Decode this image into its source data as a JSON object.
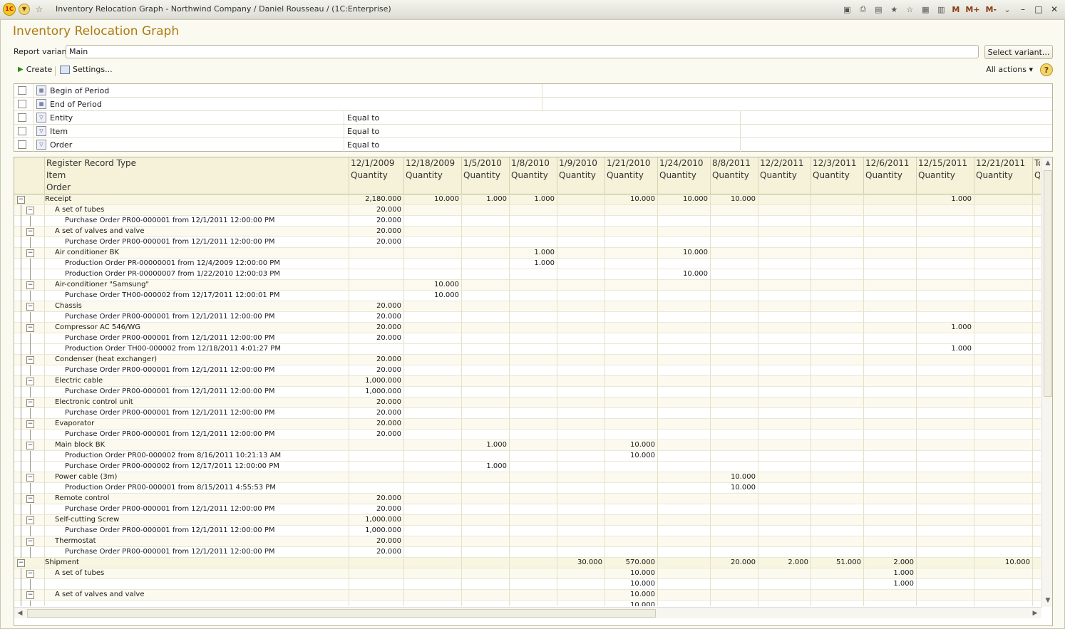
{
  "window": {
    "title": "Inventory Relocation Graph - Northwind Company / Daniel Rousseau /  (1C:Enterprise)",
    "logo": "1C",
    "memory_buttons": [
      "M",
      "M+",
      "M-"
    ]
  },
  "page": {
    "title": "Inventory Relocation Graph",
    "variant_label": "Report variant:",
    "variant_value": "Main",
    "select_variant_label": "Select variant..."
  },
  "toolbar": {
    "create_label": "Create",
    "settings_label": "Settings...",
    "all_actions_label": "All actions ▾",
    "help_label": "?"
  },
  "filters": [
    {
      "name": "Begin of Period",
      "condition": "",
      "icon": "calendar-icon"
    },
    {
      "name": "End of Period",
      "condition": "",
      "icon": "calendar-icon"
    },
    {
      "name": "Entity",
      "condition": "Equal to",
      "icon": "filter-icon"
    },
    {
      "name": "Item",
      "condition": "Equal to",
      "icon": "filter-icon"
    },
    {
      "name": "Order",
      "condition": "Equal to",
      "icon": "filter-icon"
    }
  ],
  "report": {
    "header_groups": [
      "Register Record Type",
      "Item",
      "Order"
    ],
    "dates": [
      "12/1/2009",
      "12/18/2009",
      "1/5/2010",
      "1/8/2010",
      "1/9/2010",
      "1/21/2010",
      "1/24/2010",
      "8/8/2011",
      "12/2/2011",
      "12/3/2011",
      "12/6/2011",
      "12/15/2011",
      "12/21/2011",
      "To"
    ],
    "measure": "Quantity",
    "rows": [
      {
        "level": 0,
        "label": "Receipt",
        "values": [
          "2,180.000",
          "10.000",
          "1.000",
          "1.000",
          "",
          "10.000",
          "10.000",
          "10.000",
          "",
          "",
          "",
          "1.000",
          ""
        ]
      },
      {
        "level": 1,
        "label": "A set of tubes",
        "values": [
          "20.000",
          "",
          "",
          "",
          "",
          "",
          "",
          "",
          "",
          "",
          "",
          "",
          ""
        ]
      },
      {
        "level": 2,
        "label": "Purchase Order PR00-000001 from 12/1/2011 12:00:00 PM",
        "values": [
          "20.000",
          "",
          "",
          "",
          "",
          "",
          "",
          "",
          "",
          "",
          "",
          "",
          ""
        ]
      },
      {
        "level": 1,
        "label": "A set of valves and valve",
        "values": [
          "20.000",
          "",
          "",
          "",
          "",
          "",
          "",
          "",
          "",
          "",
          "",
          "",
          ""
        ]
      },
      {
        "level": 2,
        "label": "Purchase Order PR00-000001 from 12/1/2011 12:00:00 PM",
        "values": [
          "20.000",
          "",
          "",
          "",
          "",
          "",
          "",
          "",
          "",
          "",
          "",
          "",
          ""
        ]
      },
      {
        "level": 1,
        "label": "Air conditioner BK",
        "values": [
          "",
          "",
          "",
          "1.000",
          "",
          "",
          "10.000",
          "",
          "",
          "",
          "",
          "",
          ""
        ]
      },
      {
        "level": 2,
        "label": "Production Order PR-00000001 from 12/4/2009 12:00:00 PM",
        "values": [
          "",
          "",
          "",
          "1.000",
          "",
          "",
          "",
          "",
          "",
          "",
          "",
          "",
          ""
        ]
      },
      {
        "level": 2,
        "label": "Production Order PR-00000007 from 1/22/2010 12:00:03 PM",
        "values": [
          "",
          "",
          "",
          "",
          "",
          "",
          "10.000",
          "",
          "",
          "",
          "",
          "",
          ""
        ]
      },
      {
        "level": 1,
        "label": "Air-conditioner \"Samsung\"",
        "values": [
          "",
          "10.000",
          "",
          "",
          "",
          "",
          "",
          "",
          "",
          "",
          "",
          "",
          ""
        ]
      },
      {
        "level": 2,
        "label": "Purchase Order TH00-000002 from 12/17/2011 12:00:01 PM",
        "values": [
          "",
          "10.000",
          "",
          "",
          "",
          "",
          "",
          "",
          "",
          "",
          "",
          "",
          ""
        ]
      },
      {
        "level": 1,
        "label": "Chassis",
        "values": [
          "20.000",
          "",
          "",
          "",
          "",
          "",
          "",
          "",
          "",
          "",
          "",
          "",
          ""
        ]
      },
      {
        "level": 2,
        "label": "Purchase Order PR00-000001 from 12/1/2011 12:00:00 PM",
        "values": [
          "20.000",
          "",
          "",
          "",
          "",
          "",
          "",
          "",
          "",
          "",
          "",
          "",
          ""
        ]
      },
      {
        "level": 1,
        "label": "Compressor AC 546/WG",
        "values": [
          "20.000",
          "",
          "",
          "",
          "",
          "",
          "",
          "",
          "",
          "",
          "",
          "1.000",
          ""
        ]
      },
      {
        "level": 2,
        "label": "Purchase Order PR00-000001 from 12/1/2011 12:00:00 PM",
        "values": [
          "20.000",
          "",
          "",
          "",
          "",
          "",
          "",
          "",
          "",
          "",
          "",
          "",
          ""
        ]
      },
      {
        "level": 2,
        "label": "Production Order TH00-000002 from 12/18/2011 4:01:27 PM",
        "values": [
          "",
          "",
          "",
          "",
          "",
          "",
          "",
          "",
          "",
          "",
          "",
          "1.000",
          ""
        ]
      },
      {
        "level": 1,
        "label": "Condenser (heat exchanger)",
        "values": [
          "20.000",
          "",
          "",
          "",
          "",
          "",
          "",
          "",
          "",
          "",
          "",
          "",
          ""
        ]
      },
      {
        "level": 2,
        "label": "Purchase Order PR00-000001 from 12/1/2011 12:00:00 PM",
        "values": [
          "20.000",
          "",
          "",
          "",
          "",
          "",
          "",
          "",
          "",
          "",
          "",
          "",
          ""
        ]
      },
      {
        "level": 1,
        "label": "Electric cable",
        "values": [
          "1,000.000",
          "",
          "",
          "",
          "",
          "",
          "",
          "",
          "",
          "",
          "",
          "",
          ""
        ]
      },
      {
        "level": 2,
        "label": "Purchase Order PR00-000001 from 12/1/2011 12:00:00 PM",
        "values": [
          "1,000.000",
          "",
          "",
          "",
          "",
          "",
          "",
          "",
          "",
          "",
          "",
          "",
          ""
        ]
      },
      {
        "level": 1,
        "label": "Electronic control unit",
        "values": [
          "20.000",
          "",
          "",
          "",
          "",
          "",
          "",
          "",
          "",
          "",
          "",
          "",
          ""
        ]
      },
      {
        "level": 2,
        "label": "Purchase Order PR00-000001 from 12/1/2011 12:00:00 PM",
        "values": [
          "20.000",
          "",
          "",
          "",
          "",
          "",
          "",
          "",
          "",
          "",
          "",
          "",
          ""
        ]
      },
      {
        "level": 1,
        "label": "Evaporator",
        "values": [
          "20.000",
          "",
          "",
          "",
          "",
          "",
          "",
          "",
          "",
          "",
          "",
          "",
          ""
        ]
      },
      {
        "level": 2,
        "label": "Purchase Order PR00-000001 from 12/1/2011 12:00:00 PM",
        "values": [
          "20.000",
          "",
          "",
          "",
          "",
          "",
          "",
          "",
          "",
          "",
          "",
          "",
          ""
        ]
      },
      {
        "level": 1,
        "label": "Main block BK",
        "values": [
          "",
          "",
          "1.000",
          "",
          "",
          "10.000",
          "",
          "",
          "",
          "",
          "",
          "",
          ""
        ]
      },
      {
        "level": 2,
        "label": "Production Order PR00-000002 from 8/16/2011 10:21:13 AM",
        "values": [
          "",
          "",
          "",
          "",
          "",
          "10.000",
          "",
          "",
          "",
          "",
          "",
          "",
          ""
        ]
      },
      {
        "level": 2,
        "label": "Purchase Order PR00-000002 from 12/17/2011 12:00:00 PM",
        "values": [
          "",
          "",
          "1.000",
          "",
          "",
          "",
          "",
          "",
          "",
          "",
          "",
          "",
          ""
        ]
      },
      {
        "level": 1,
        "label": "Power cable (3m)",
        "values": [
          "",
          "",
          "",
          "",
          "",
          "",
          "",
          "10.000",
          "",
          "",
          "",
          "",
          ""
        ]
      },
      {
        "level": 2,
        "label": "Production Order PR00-000001 from 8/15/2011 4:55:53 PM",
        "values": [
          "",
          "",
          "",
          "",
          "",
          "",
          "",
          "10.000",
          "",
          "",
          "",
          "",
          ""
        ]
      },
      {
        "level": 1,
        "label": "Remote control",
        "values": [
          "20.000",
          "",
          "",
          "",
          "",
          "",
          "",
          "",
          "",
          "",
          "",
          "",
          ""
        ]
      },
      {
        "level": 2,
        "label": "Purchase Order PR00-000001 from 12/1/2011 12:00:00 PM",
        "values": [
          "20.000",
          "",
          "",
          "",
          "",
          "",
          "",
          "",
          "",
          "",
          "",
          "",
          ""
        ]
      },
      {
        "level": 1,
        "label": "Self-cutting Screw",
        "values": [
          "1,000.000",
          "",
          "",
          "",
          "",
          "",
          "",
          "",
          "",
          "",
          "",
          "",
          ""
        ]
      },
      {
        "level": 2,
        "label": "Purchase Order PR00-000001 from 12/1/2011 12:00:00 PM",
        "values": [
          "1,000.000",
          "",
          "",
          "",
          "",
          "",
          "",
          "",
          "",
          "",
          "",
          "",
          ""
        ]
      },
      {
        "level": 1,
        "label": "Thermostat",
        "values": [
          "20.000",
          "",
          "",
          "",
          "",
          "",
          "",
          "",
          "",
          "",
          "",
          "",
          ""
        ]
      },
      {
        "level": 2,
        "label": "Purchase Order PR00-000001 from 12/1/2011 12:00:00 PM",
        "values": [
          "20.000",
          "",
          "",
          "",
          "",
          "",
          "",
          "",
          "",
          "",
          "",
          "",
          ""
        ]
      },
      {
        "level": 0,
        "label": "Shipment",
        "values": [
          "",
          "",
          "",
          "",
          "30.000",
          "570.000",
          "",
          "20.000",
          "2.000",
          "51.000",
          "2.000",
          "",
          "10.000"
        ]
      },
      {
        "level": 1,
        "label": "A set of tubes",
        "values": [
          "",
          "",
          "",
          "",
          "",
          "10.000",
          "",
          "",
          "",
          "",
          "1.000",
          "",
          ""
        ]
      },
      {
        "level": 2,
        "label": "",
        "values": [
          "",
          "",
          "",
          "",
          "",
          "10.000",
          "",
          "",
          "",
          "",
          "1.000",
          "",
          ""
        ]
      },
      {
        "level": 1,
        "label": "A set of valves and valve",
        "values": [
          "",
          "",
          "",
          "",
          "",
          "10.000",
          "",
          "",
          "",
          "",
          "",
          "",
          ""
        ]
      },
      {
        "level": 2,
        "label": "",
        "values": [
          "",
          "",
          "",
          "",
          "",
          "10.000",
          "",
          "",
          "",
          "",
          "",
          "",
          ""
        ]
      }
    ]
  },
  "colors": {
    "title": "#ad7a0f",
    "header_bg": "#f5f2d9",
    "group_bg": "#f8f5e0",
    "accent_icon": "#f6d46c"
  }
}
